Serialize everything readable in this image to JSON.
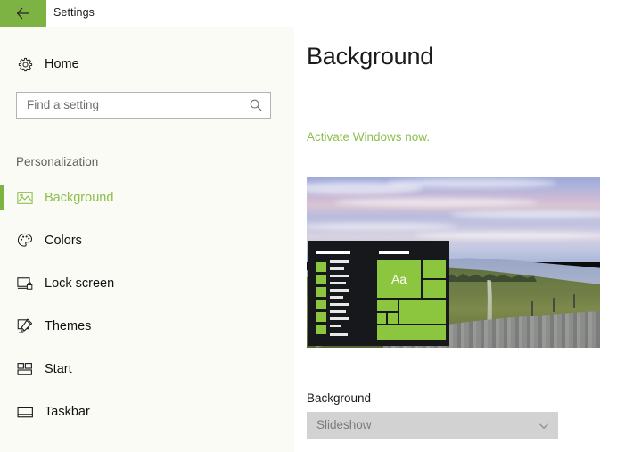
{
  "window": {
    "title": "Settings",
    "back_icon": "arrow-left-icon",
    "accent_color": "#7cb342"
  },
  "sidebar": {
    "home": {
      "label": "Home",
      "icon": "gear-icon"
    },
    "search": {
      "placeholder": "Find a setting",
      "value": "",
      "icon": "search-icon"
    },
    "section_header": "Personalization",
    "selected": "Background",
    "items": [
      {
        "label": "Background",
        "icon": "picture-icon",
        "selected": true
      },
      {
        "label": "Colors",
        "icon": "palette-icon",
        "selected": false
      },
      {
        "label": "Lock screen",
        "icon": "lock-screen-icon",
        "selected": false
      },
      {
        "label": "Themes",
        "icon": "paintbrush-icon",
        "selected": false
      },
      {
        "label": "Start",
        "icon": "start-tiles-icon",
        "selected": false
      },
      {
        "label": "Taskbar",
        "icon": "taskbar-icon",
        "selected": false
      }
    ]
  },
  "main": {
    "page_title": "Background",
    "activate_link": "Activate Windows now.",
    "preview": {
      "alt": "desktop-preview-landscape-with-start-menu",
      "tile_text": "Aa"
    },
    "background_setting": {
      "label": "Background",
      "selected_value": "Slideshow",
      "chevron_icon": "chevron-down-icon",
      "disabled": true
    }
  }
}
